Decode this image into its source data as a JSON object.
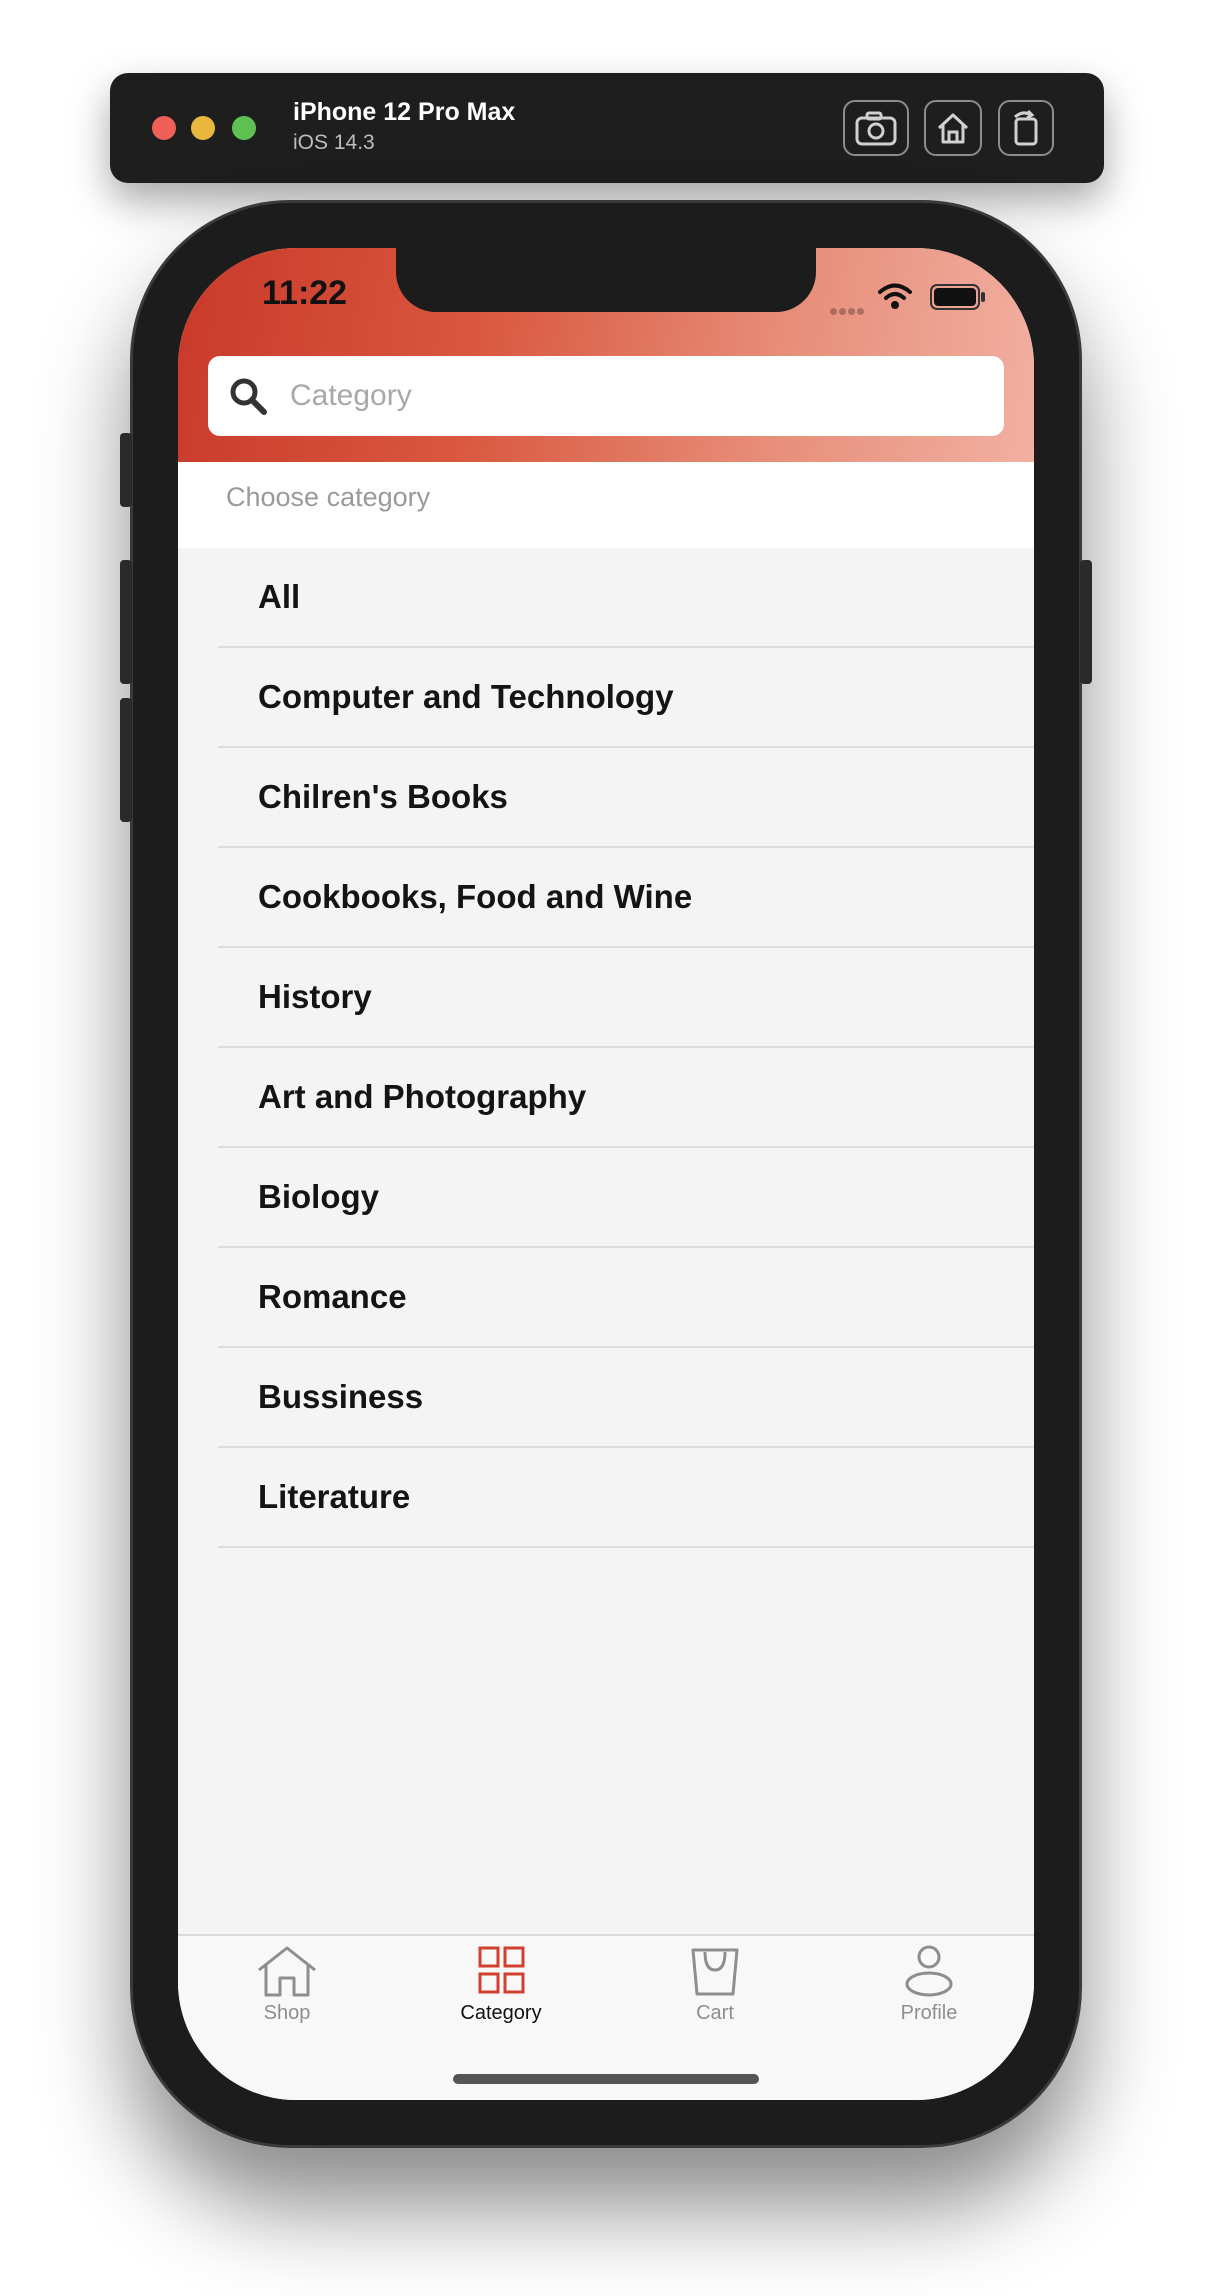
{
  "simulator": {
    "device_name": "iPhone 12 Pro Max",
    "os_version": "iOS 14.3",
    "buttons": [
      "screenshot-icon",
      "home-icon",
      "rotate-icon"
    ]
  },
  "status_bar": {
    "time": "11:22"
  },
  "search": {
    "placeholder": "Category",
    "value": ""
  },
  "section": {
    "label": "Choose category"
  },
  "categories": [
    "All",
    "Computer and Technology",
    "Chilren's Books",
    "Cookbooks, Food and Wine",
    "History",
    "Art and Photography",
    "Biology",
    "Romance",
    "Bussiness",
    "Literature"
  ],
  "tabbar": {
    "tabs": [
      {
        "label": "Shop",
        "icon": "home-icon",
        "active": false
      },
      {
        "label": "Category",
        "icon": "grid-icon",
        "active": true
      },
      {
        "label": "Cart",
        "icon": "bag-icon",
        "active": false
      },
      {
        "label": "Profile",
        "icon": "person-icon",
        "active": false
      }
    ]
  },
  "colors": {
    "accent": "#d23f2e",
    "header_start": "#c9392a",
    "header_end": "#f2b0a2",
    "list_background": "#f4f4f4"
  }
}
